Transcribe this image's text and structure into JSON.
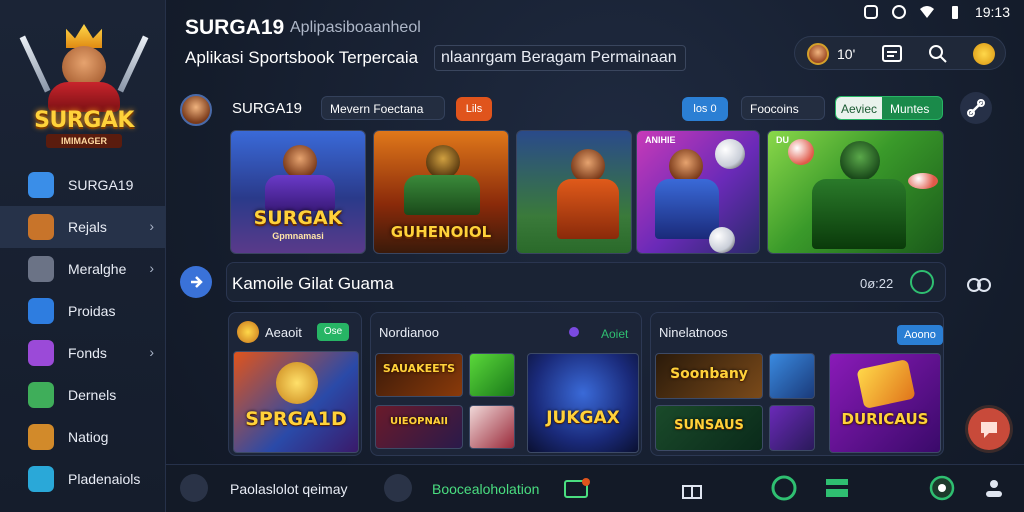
{
  "status_bar": {
    "time": "19:13"
  },
  "header": {
    "title": "SURGA19",
    "title_sub": "Aplipasiboaanheol",
    "tagline": "Aplikasi Sportsbook Terpercaia",
    "tagline_chip": "nlaanrgam Beragam Permainaan",
    "profile_count": "10'"
  },
  "sidebar": {
    "logo_word": "SURGAK",
    "logo_sub": "IMIMAGER",
    "items": [
      {
        "label": "SURGA19",
        "icon": "star-icon",
        "color": "#3a8ee8"
      },
      {
        "label": "Rejals",
        "icon": "hero-icon",
        "color": "#c8742a",
        "active": true,
        "chevron": true
      },
      {
        "label": "Meralghe",
        "icon": "fist-icon",
        "color": "#6b7386",
        "chevron": true
      },
      {
        "label": "Proidas",
        "icon": "promo-icon",
        "color": "#2e7de0"
      },
      {
        "label": "Fonds",
        "icon": "coins-icon",
        "color": "#9b4ad8",
        "chevron": true
      },
      {
        "label": "Dernels",
        "icon": "deals-icon",
        "color": "#3fae5a"
      },
      {
        "label": "Natiog",
        "icon": "player-icon",
        "color": "#d28a2a"
      },
      {
        "label": "Pladenaiols",
        "icon": "group-icon",
        "color": "#2aa8d8"
      }
    ]
  },
  "toolbar": {
    "name": "SURGA19",
    "tag1": "Mevern Foectana",
    "tag2": "Lils",
    "tag3": "los 0",
    "tag4": "Foocoins",
    "tag5_left": "Aeviec",
    "tag5_right": "Muntes"
  },
  "banners": [
    {
      "title": "SURGAK",
      "sub": "Gpmnamasi"
    },
    {
      "title": "GUHENOIOL",
      "sub": ""
    },
    {
      "title": "",
      "sub": ""
    },
    {
      "title": "",
      "sub": "",
      "tag": "ANIHIE"
    },
    {
      "title": "",
      "sub": "",
      "tag": "DU"
    }
  ],
  "section": {
    "title": "Kamoile Gilat Guama",
    "count": "0ø:22"
  },
  "cards": [
    {
      "head": "Aeaoit",
      "badge": "Ose",
      "game_title": "SPRGA1D"
    },
    {
      "head": "Nordianoo",
      "badge": "Aoiet",
      "games": [
        "SAUAKEETS",
        "UIEOPNAII",
        "JUKGAX"
      ]
    },
    {
      "head": "Ninelatnoos",
      "badge": "Aoono",
      "games": [
        "Soonbany",
        "SUNSAUS",
        "DURICAUS"
      ]
    }
  ],
  "bottom_bar": {
    "item1": "Paolaslolot qeimay",
    "item2": "Boocealoholation"
  }
}
